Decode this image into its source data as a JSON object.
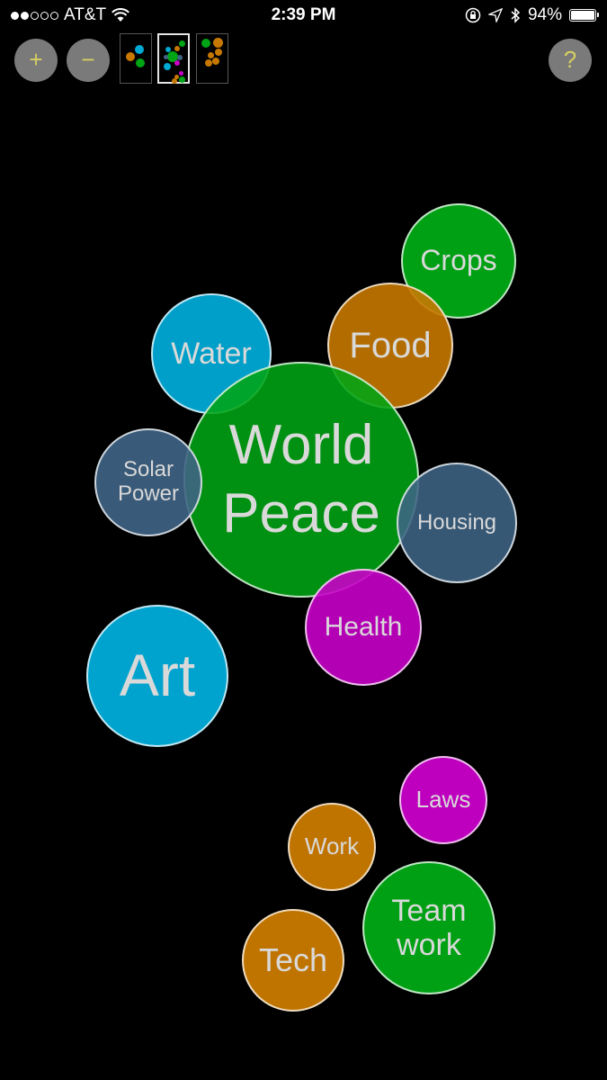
{
  "status_bar": {
    "carrier": "AT&T",
    "time": "2:39 PM",
    "battery_percent": "94%",
    "signal_bars": 2
  },
  "toolbar": {
    "zoom_in_label": "+",
    "zoom_out_label": "−",
    "help_label": "?",
    "selected_thumbnail": 2
  },
  "bubbles": {
    "crops": "Crops",
    "food": "Food",
    "water": "Water",
    "world_peace": "World\nPeace",
    "solar_power": "Solar\nPower",
    "housing": "Housing",
    "health": "Health",
    "art": "Art",
    "laws": "Laws",
    "work": "Work",
    "teamwork": "Team\nwork",
    "tech": "Tech"
  },
  "colors": {
    "green": "#00a515",
    "orange": "#c67800",
    "blue": "#00a8d4",
    "slate": "#3f6485",
    "magenta": "#c800c8",
    "button_gray": "#7a7a7a",
    "button_glyph": "#d6cf63"
  }
}
